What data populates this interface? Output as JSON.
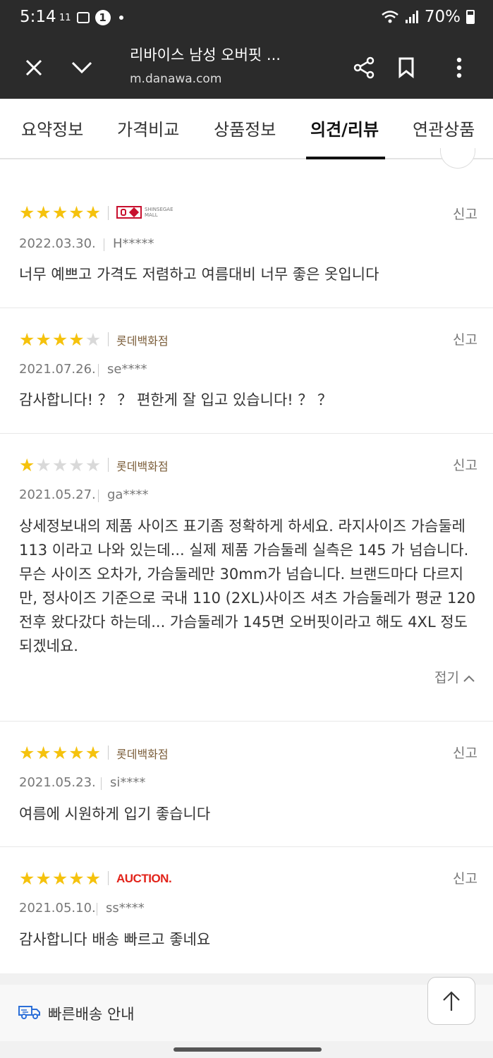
{
  "status_bar": {
    "time": "5:14",
    "left_icons": [
      "signal-11-icon",
      "gallery-icon",
      "notification-count-icon",
      "dot-icon"
    ],
    "notification_count": "1",
    "carrier_label": "11",
    "battery": "70%"
  },
  "browser": {
    "title": "리바이스 남성 오버핏 ...",
    "url": "m.danawa.com"
  },
  "tabs": [
    {
      "label": "요약정보"
    },
    {
      "label": "가격비교"
    },
    {
      "label": "상품정보"
    },
    {
      "label": "의견/리뷰",
      "active": true
    },
    {
      "label": "연관상품"
    }
  ],
  "reviews": [
    {
      "rating": 5,
      "mall_logo": "ssgf-logo",
      "mall_text": "SHINSEGAE MALL",
      "date": "2022.03.30.",
      "user": "H*****",
      "report": "신고",
      "content": "너무 예쁘고 가격도 저렴하고 여름대비 너무 좋은 옷입니다"
    },
    {
      "rating": 4,
      "mall": "롯데백화점",
      "date": "2021.07.26.",
      "user": "se****",
      "report": "신고",
      "content": "감사합니다! ？ ？ 편한게 잘 입고 있습니다! ？ ？"
    },
    {
      "rating": 1,
      "mall": "롯데백화점",
      "date": "2021.05.27.",
      "user": "ga****",
      "report": "신고",
      "content": "상세정보내의 제품 사이즈 표기좀 정확하게 하세요. 라지사이즈 가슴둘레 113 이라고 나와 있는데... 실제 제품 가슴둘레 실측은 145 가 넘습니다. 무슨 사이즈 오차가, 가슴둘레만 30mm가 넘습니다. 브랜드마다 다르지만, 정사이즈 기준으로 국내 110 (2XL)사이즈 셔츠 가슴둘레가 평균 120전후 왔다갔다 하는데... 가슴둘레가 145면 오버핏이라고 해도 4XL 정도 되겠네요.",
      "fold_label": "접기"
    },
    {
      "rating": 5,
      "mall": "롯데백화점",
      "date": "2021.05.23.",
      "user": "si****",
      "report": "신고",
      "content": "여름에 시원하게 입기 좋습니다"
    },
    {
      "rating": 5,
      "mall": "AUCTION.",
      "date": "2021.05.10.",
      "user": "ss****",
      "report": "신고",
      "content": "감사합니다 배송 빠르고 좋네요"
    }
  ],
  "banner": {
    "label": "빠른배송 안내",
    "icon": "truck-icon"
  },
  "colors": {
    "star_on": "#f5c20d",
    "star_off": "#d9d9d9",
    "dark_bar": "#2b2b2b",
    "auction_red": "#e2231a"
  }
}
